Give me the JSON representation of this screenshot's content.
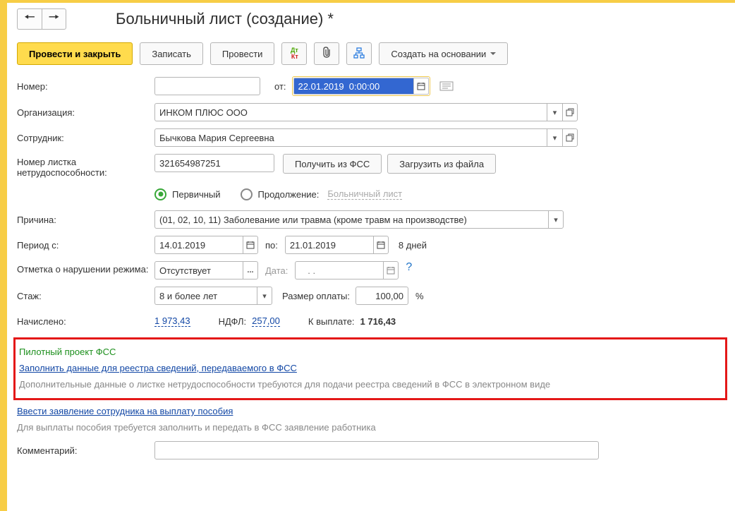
{
  "header": {
    "title": "Больничный лист (создание) *"
  },
  "toolbar": {
    "post_and_close": "Провести и закрыть",
    "save": "Записать",
    "post": "Провести",
    "create_based_on": "Создать на основании"
  },
  "labels": {
    "number": "Номер:",
    "from": "от:",
    "organization": "Организация:",
    "employee": "Сотрудник:",
    "sickleave_number": "Номер листка нетрудоспособности:",
    "get_from_fss": "Получить из ФСС",
    "load_from_file": "Загрузить из файла",
    "primary": "Первичный",
    "continuation": "Продолжение:",
    "sick_leave_link": "Больничный лист",
    "reason": "Причина:",
    "period_from": "Период с:",
    "period_to": "по:",
    "days_text": "8 дней",
    "violation": "Отметка о нарушении режима:",
    "violation_date": "Дата:",
    "violation_date_placeholder": "   . .   ",
    "seniority": "Стаж:",
    "payment_rate": "Размер оплаты:",
    "percent": "%",
    "accrued": "Начислено:",
    "ndfl": "НДФЛ:",
    "to_pay": "К выплате:",
    "comment": "Комментарий:"
  },
  "fields": {
    "number": "",
    "date": "22.01.2019  0:00:00",
    "organization": "ИНКОМ ПЛЮС ООО",
    "employee": "Бычкова Мария Сергеевна",
    "sickleave_number": "321654987251",
    "reason": "(01, 02, 10, 11) Заболевание или травма (кроме травм на производстве)",
    "period_from": "14.01.2019",
    "period_to": "21.01.2019",
    "violation": "Отсутствует",
    "seniority": "8 и более лет",
    "payment_rate": "100,00",
    "accrued": "1 973,43",
    "ndfl": "257,00",
    "to_pay": "1 716,43",
    "comment": ""
  },
  "pilot_section": {
    "title": "Пилотный проект ФСС",
    "fill_link": "Заполнить данные для реестра сведений, передаваемого в ФСС",
    "hint": "Дополнительные данные о листке нетрудоспособности требуются для подачи реестра сведений в ФСС в электронном виде"
  },
  "application_section": {
    "link": "Ввести заявление сотрудника на выплату пособия",
    "hint": "Для выплаты пособия требуется заполнить и передать в ФСС заявление работника"
  }
}
